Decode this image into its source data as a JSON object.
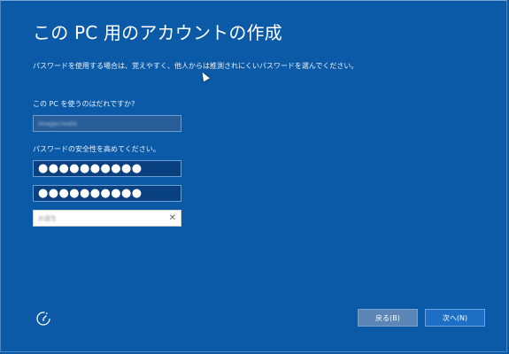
{
  "page": {
    "title": "この PC 用のアカウントの作成",
    "description": "パスワードを使用する場合は、覚えやすく、他人からは推測されにくいパスワードを選んでください。"
  },
  "form": {
    "user_label": "この PC を使うのはだれですか?",
    "username_value": "imagecreate",
    "password_label": "パスワードの安全性を高めてください。",
    "password_mask": "●●●●●●●●●●",
    "password_confirm_mask": "●●●●●●●●●●",
    "hint_value": "お誕生",
    "clear_glyph": "✕"
  },
  "footer": {
    "back_label": "戻る(B)",
    "next_label": "次へ(N)"
  },
  "icons": {
    "ease_of_access": "ease-of-access-icon",
    "clear": "clear-icon",
    "cursor": "mouse-cursor-icon"
  },
  "colors": {
    "background": "#0b5aa7",
    "field_bg": "#09407f",
    "back_button": "#5b86b6",
    "next_button": "#1c6fc4"
  }
}
